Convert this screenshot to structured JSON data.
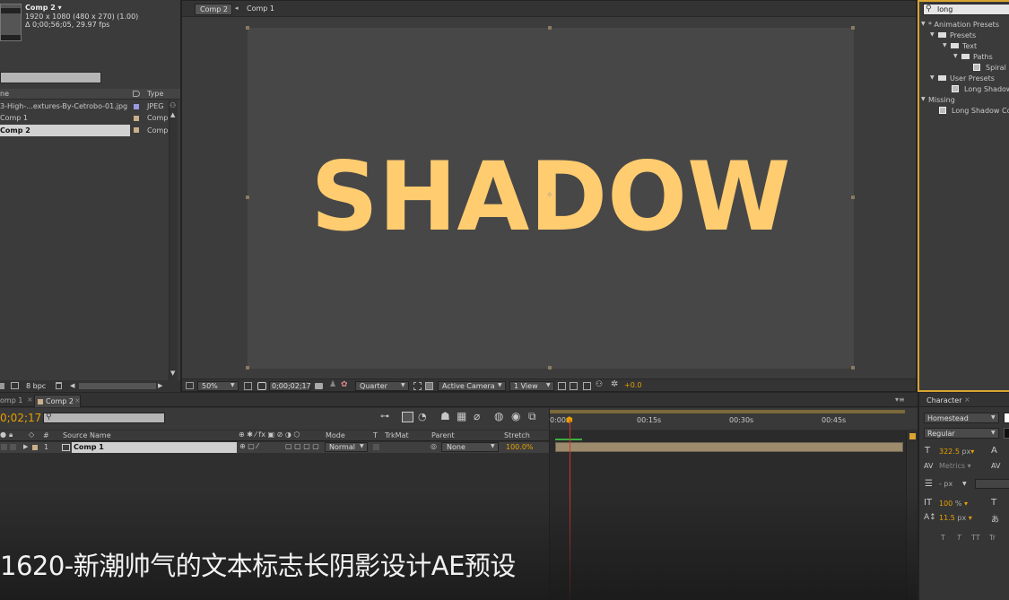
{
  "project": {
    "comp_name": "Comp 2 ▾",
    "comp_info_1": "1920 x 1080  (480 x 270) (1.00)",
    "comp_info_2": "Δ 0;00;56;05, 29.97 fps",
    "col_name": "ne",
    "col_type": "Type",
    "items": [
      {
        "name": "3-High-...extures-By-Cetrobo-01.jpg",
        "type": "JPEG"
      },
      {
        "name": "Comp 1",
        "type": "Comp"
      },
      {
        "name": "Comp 2",
        "type": "Comp"
      }
    ],
    "bpc": "8 bpc"
  },
  "viewer": {
    "tabs": [
      "Comp 2",
      "Comp 1"
    ],
    "canvas_text": "SHADOW",
    "zoom": "50%",
    "timecode": "0;00;02;17",
    "resolution": "Quarter",
    "camera": "Active Camera",
    "views": "1 View",
    "exposure": "+0.0"
  },
  "effects": {
    "search_value": "long",
    "tree": [
      {
        "label": "* Animation Presets",
        "level": 0,
        "kind": "folder"
      },
      {
        "label": "Presets",
        "level": 1,
        "kind": "folder"
      },
      {
        "label": "Text",
        "level": 2,
        "kind": "folder"
      },
      {
        "label": "Paths",
        "level": 3,
        "kind": "folder"
      },
      {
        "label": "Spiral L",
        "level": 4,
        "kind": "preset"
      },
      {
        "label": "User Presets",
        "level": 1,
        "kind": "folder"
      },
      {
        "label": "Long Shadow",
        "level": 2,
        "kind": "preset"
      },
      {
        "label": "Missing",
        "level": 0,
        "kind": "folder"
      },
      {
        "label": "Long Shadow Co",
        "level": 2,
        "kind": "preset"
      }
    ]
  },
  "timeline": {
    "tabs": [
      "omp 1",
      "Comp 2"
    ],
    "current_time": "0;02;17",
    "search_placeholder": "",
    "col_source": "Source Name",
    "col_mode": "Mode",
    "col_t": "T",
    "col_trkmat": "TrkMat",
    "col_parent": "Parent",
    "col_stretch": "Stretch",
    "col_num": "#",
    "layer": {
      "num": "1",
      "name": "Comp 1",
      "mode": "Normal",
      "parent": "None",
      "stretch": "100.0%"
    },
    "ruler": [
      "0:00s",
      "00:15s",
      "00:30s",
      "00:45s"
    ]
  },
  "character": {
    "tab": "Character",
    "font": "Homestead",
    "style": "Regular",
    "size": "322.5",
    "size_unit": "px",
    "kerning": "Metrics",
    "leading": "- px",
    "vscale": "100",
    "vscale_unit": "%",
    "baseline": "11.5",
    "baseline_unit": "px",
    "styles": [
      "T",
      "T",
      "TT",
      "Tr"
    ]
  },
  "subtitle": "1620-新潮帅气的文本标志长阴影设计AE预设",
  "colors": {
    "accent": "#e8a000",
    "canvas_text": "#ffcc70",
    "canvas_bg": "#474747",
    "bar_orange": "#d9a531",
    "highlight": "#d8d8d8"
  }
}
